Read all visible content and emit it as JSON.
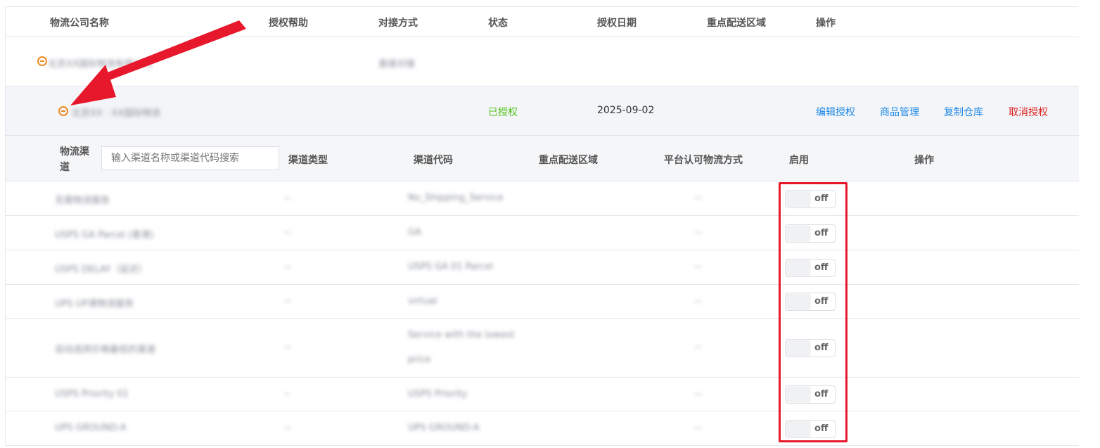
{
  "columns": {
    "company": "物流公司名称",
    "auth_help": "授权帮助",
    "connect_method": "对接方式",
    "status": "状态",
    "auth_date": "授权日期",
    "key_region": "重点配送区域",
    "actions": "操作"
  },
  "company_row": {
    "name": "北京XX国际物流有限公司",
    "connect_method": "直接对接"
  },
  "account_row": {
    "name": "北京XX · XX国际物流",
    "status": "已授权",
    "date": "2025-09-02",
    "actions": [
      "编辑授权",
      "商品管理",
      "复制仓库",
      "取消授权"
    ]
  },
  "channel_header": {
    "channel_line1": "物流渠",
    "channel_line2": "道",
    "search_placeholder": "输入渠道名称或渠道代码搜索",
    "type": "渠道类型",
    "code": "渠道代码",
    "region": "重点配送区域",
    "platform_method": "平台认可物流方式",
    "enable": "启用",
    "action": "操作"
  },
  "channels": [
    {
      "name": "无需物流服务",
      "type": "--",
      "code": "No_Shipping_Service",
      "code2": "",
      "platform": "--",
      "enabled": "off"
    },
    {
      "name": "USPS GA Parcel (香港)",
      "type": "--",
      "code": "GA",
      "code2": "",
      "platform": "--",
      "enabled": "off"
    },
    {
      "name": "USPS DELAY（延迟）",
      "type": "--",
      "code": "USPS GA 01 Parcel",
      "code2": "",
      "platform": "--",
      "enabled": "off"
    },
    {
      "name": "UPS UP港物流服务",
      "type": "--",
      "code": "virtual",
      "code2": "",
      "platform": "--",
      "enabled": "off"
    },
    {
      "name": "自动选择价格最低的渠道",
      "type": "--",
      "code": "Service with the lowest",
      "code2": "price",
      "platform": "--",
      "enabled": "off"
    },
    {
      "name": "USPS Priority 01",
      "type": "--",
      "code": "USPS Priority",
      "code2": "",
      "platform": "--",
      "enabled": "off"
    },
    {
      "name": "UPS GROUND-A",
      "type": "--",
      "code": "UPS GROUND-A",
      "code2": "",
      "platform": "--",
      "enabled": "off"
    }
  ],
  "colors": {
    "accent": "#1e88e5",
    "success": "#52c41a",
    "danger": "#e02020",
    "highlight": "#e8182c"
  }
}
